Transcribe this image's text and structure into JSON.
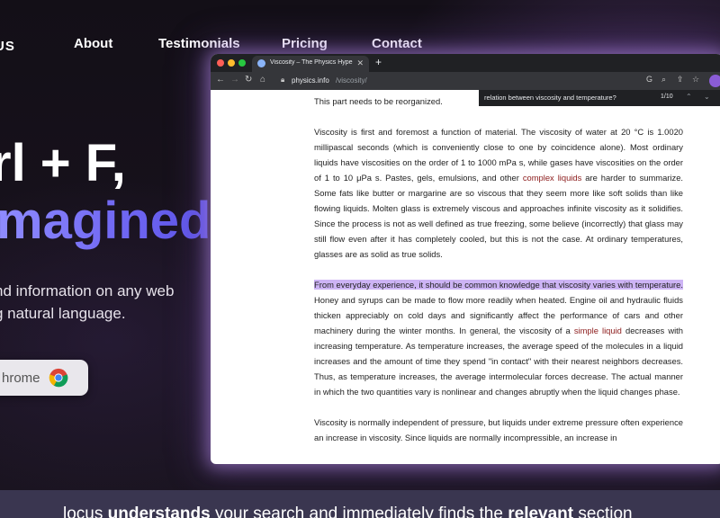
{
  "nav": {
    "brand": "US",
    "items": [
      "About",
      "Testimonials",
      "Pricing",
      "Contact"
    ]
  },
  "hero": {
    "line1": "rl + F,",
    "line2": "magined",
    "sub_line1": "nd information on any web",
    "sub_line2": "g natural language.",
    "cta_label": "hrome"
  },
  "browser": {
    "tab_title": "Viscosity – The Physics Hyperte",
    "url_host": "physics.info",
    "url_path": "/viscosity/",
    "find_query": "relation between viscosity and temperature?",
    "find_count": "1/10"
  },
  "article": {
    "p0": "This part needs to be reorganized.",
    "p1_a": "Viscosity is first and foremost a function of material. The viscosity of water at 20 °C is 1.0020 millipascal seconds (which is conveniently close to one by coincidence alone). Most ordinary liquids have viscosities on the order of 1 to 1000 mPa s, while gases have viscosities on the order of 1 to 10 μPa s. Pastes, gels, emulsions, and other ",
    "p1_link": "complex liquids",
    "p1_b": " are harder to summarize. Some fats like butter or margarine are so viscous that they seem more like soft solids than like flowing liquids. Molten glass is extremely viscous and approaches infinite viscosity as it solidifies. Since the process is not as well defined as true freezing, some believe (incorrectly) that glass may still flow even after it has completely cooled, but this is not the case. At ordinary temperatures, glasses are as solid as true solids.",
    "p2_hl": "From everyday experience, it should be common knowledge that viscosity varies with temperature.",
    "p2_a": " Honey and syrups can be made to flow more readily when heated. Engine oil and hydraulic fluids thicken appreciably on cold days and significantly affect the performance of cars and other machinery during the winter months. In general, the viscosity of a ",
    "p2_link": "simple liquid",
    "p2_b": " decreases with increasing temperature. As temperature increases, the average speed of the molecules in a liquid increases and the amount of time they spend \"in contact\" with their nearest neighbors decreases. Thus, as temperature increases, the average intermolecular forces decrease. The actual manner in which the two quantities vary is nonlinear and changes abruptly when the liquid changes phase.",
    "p3": "Viscosity is normally independent of pressure, but liquids under extreme pressure often experience an increase in viscosity. Since liquids are normally incompressible, an increase in"
  },
  "bottom": {
    "t1": "locus ",
    "t2": "understands",
    "t3": " your search and  immediately finds the ",
    "t4": "relevant",
    "t5": " section"
  },
  "colors": {
    "accent": "#6f66f2",
    "highlight": "#cdb4f5",
    "link": "#8b1a1a",
    "glow": "#b48ce6"
  },
  "icons": [
    "chrome-icon",
    "lock-icon",
    "google-icon",
    "search-icon",
    "share-icon",
    "star-icon",
    "back-arrow-icon",
    "forward-arrow-icon",
    "reload-icon",
    "home-icon",
    "close-icon",
    "plus-icon",
    "chevron-up-icon",
    "chevron-down-icon"
  ]
}
